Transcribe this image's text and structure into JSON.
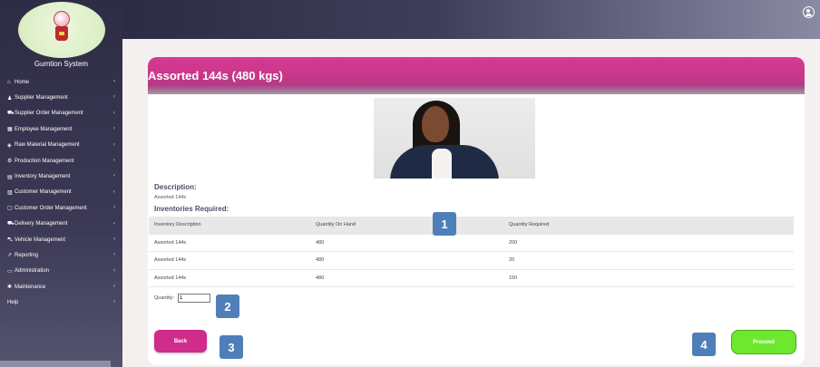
{
  "brand": "Gumtion System",
  "sidebar": {
    "items": [
      {
        "icon": "⌂",
        "label": "Home"
      },
      {
        "icon": "♟",
        "label": "Supplier Management"
      },
      {
        "icon": "⛟",
        "label": "Supplier Order Management"
      },
      {
        "icon": "▦",
        "label": "Employee Management"
      },
      {
        "icon": "◈",
        "label": "Raw Material Management"
      },
      {
        "icon": "⚙",
        "label": "Production Management"
      },
      {
        "icon": "▤",
        "label": "Inventory Management"
      },
      {
        "icon": "▥",
        "label": "Customer Management"
      },
      {
        "icon": "▢",
        "label": "Customer Order Management"
      },
      {
        "icon": "⛟",
        "label": "Delivery Management"
      },
      {
        "icon": "⛍",
        "label": "Vehicle Management"
      },
      {
        "icon": "↗",
        "label": "Reporting"
      },
      {
        "icon": "▭",
        "label": "Administration"
      },
      {
        "icon": "✱",
        "label": "Maintenance"
      },
      {
        "icon": "",
        "label": "Help"
      }
    ],
    "chevron": "‹"
  },
  "product": {
    "title": "Assorted 144s (480 kgs)",
    "description_heading": "Description:",
    "description": "Assorted 144s",
    "inventories_heading": "Inventories Required:"
  },
  "table": {
    "headers": [
      "Inventory Description",
      "Quantity On Hand",
      "Quantity Required"
    ],
    "rows": [
      [
        "Assorted 144s",
        "480",
        "200"
      ],
      [
        "Assorted 144s",
        "480",
        "20"
      ],
      [
        "Assorted 144s",
        "480",
        "150"
      ]
    ]
  },
  "quantity": {
    "label": "Quantity:",
    "value": "1"
  },
  "buttons": {
    "back": "Back",
    "proceed": "Proceed"
  },
  "badges": [
    "1",
    "2",
    "3",
    "4"
  ],
  "colors": {
    "accent": "#d63a92",
    "proceed": "#6ee82e",
    "badge": "#4f7fb8",
    "sidebar": "#2f2d45"
  }
}
